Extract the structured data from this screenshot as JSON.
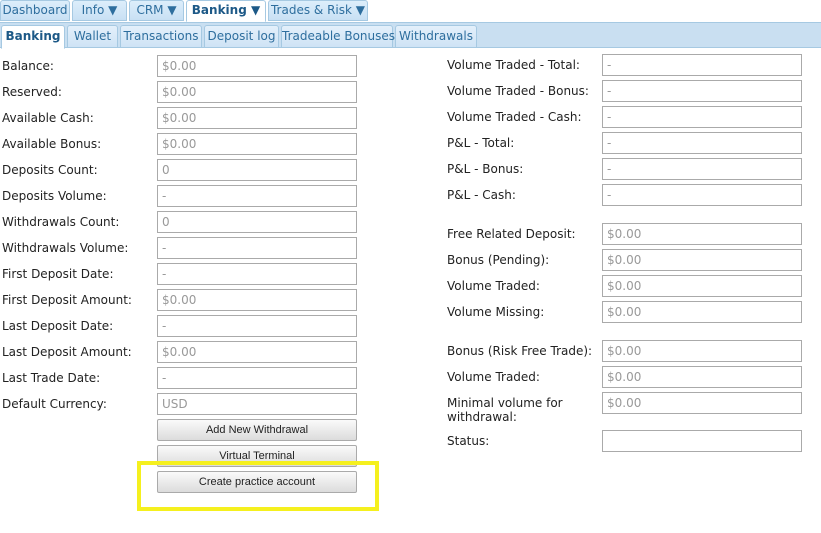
{
  "top_tabs": [
    "Dashboard",
    "Info ▼",
    "CRM ▼",
    "Banking ▼",
    "Trades & Risk ▼"
  ],
  "sub_tabs": [
    "Banking",
    "Wallet",
    "Transactions",
    "Deposit log",
    "Tradeable Bonuses",
    "Withdrawals"
  ],
  "left_fields": [
    {
      "label": "Balance:",
      "value": "$0.00"
    },
    {
      "label": "Reserved:",
      "value": "$0.00"
    },
    {
      "label": "Available Cash:",
      "value": "$0.00"
    },
    {
      "label": "Available Bonus:",
      "value": "$0.00"
    },
    {
      "label": "Deposits Count:",
      "value": "0"
    },
    {
      "label": "Deposits Volume:",
      "value": "-"
    },
    {
      "label": "Withdrawals Count:",
      "value": "0"
    },
    {
      "label": "Withdrawals Volume:",
      "value": "-"
    },
    {
      "label": "First Deposit Date:",
      "value": "-"
    },
    {
      "label": "First Deposit Amount:",
      "value": "$0.00"
    },
    {
      "label": "Last Deposit Date:",
      "value": "-"
    },
    {
      "label": "Last Deposit Amount:",
      "value": "$0.00"
    },
    {
      "label": "Last Trade Date:",
      "value": "-"
    },
    {
      "label": "Default Currency:",
      "value": "USD"
    }
  ],
  "right_fields": [
    {
      "label": "Volume Traded - Total:",
      "value": "-"
    },
    {
      "label": "Volume Traded - Bonus:",
      "value": "-"
    },
    {
      "label": "Volume Traded - Cash:",
      "value": "-"
    },
    {
      "label": "P&L - Total:",
      "value": "-"
    },
    {
      "label": "P&L - Bonus:",
      "value": "-"
    },
    {
      "label": "P&L - Cash:",
      "value": "-"
    },
    {
      "label": "Free Related Deposit:",
      "value": "$0.00"
    },
    {
      "label": "Bonus (Pending):",
      "value": "$0.00"
    },
    {
      "label": "Volume Traded:",
      "value": "$0.00"
    },
    {
      "label": "Volume Missing:",
      "value": "$0.00"
    },
    {
      "label": "Bonus (Risk Free Trade):",
      "value": "$0.00"
    },
    {
      "label": "Volume Traded:",
      "value": "$0.00"
    },
    {
      "label": "Minimal volume for withdrawal:",
      "value": "$0.00"
    },
    {
      "label": "Status:",
      "value": ""
    }
  ],
  "buttons": {
    "add_withdrawal": "Add New Withdrawal",
    "virtual_terminal": "Virtual Terminal",
    "create_practice": "Create practice account"
  },
  "colors": {
    "highlight": "#f5f01e",
    "tab_text": "#2e6e9e",
    "tab_bar": "#c9dff1"
  }
}
